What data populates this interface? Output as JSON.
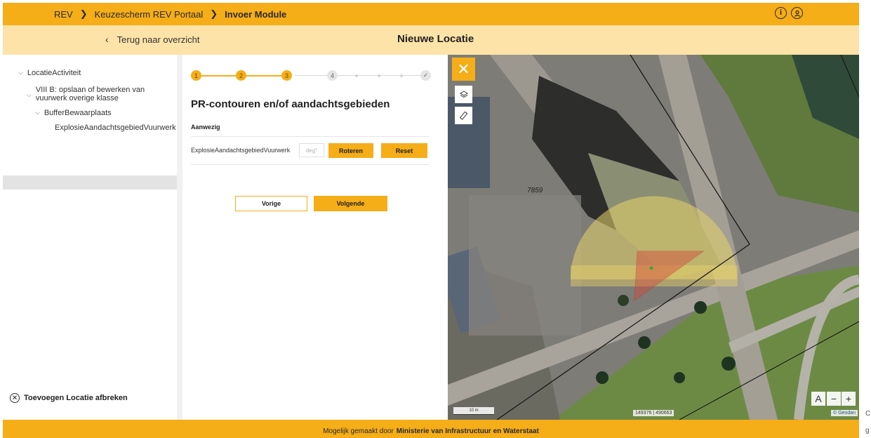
{
  "header": {
    "breadcrumbs": [
      "REV",
      "Keuzescherm REV Portaal",
      "Invoer Module"
    ],
    "info_icon": "info-icon",
    "user_icon": "user-icon"
  },
  "subheader": {
    "back_label": "Terug naar overzicht",
    "title": "Nieuwe Locatie"
  },
  "sidebar": {
    "tree": [
      {
        "label": "LocatieActiviteit",
        "level": 0,
        "expanded": true
      },
      {
        "label": "VIII B: opslaan of bewerken van",
        "label2": "vuurwerk overige klasse",
        "level": 1,
        "expanded": true
      },
      {
        "label": "BufferBewaarplaats",
        "level": 2,
        "expanded": true
      },
      {
        "label": "ExplosieAandachtsgebiedVuurwerk",
        "level": 3,
        "selected": true
      }
    ],
    "abort_label": "Toevoegen Locatie afbreken"
  },
  "stepper": {
    "steps": [
      "1",
      "2",
      "3",
      "4",
      "✓"
    ],
    "current": 3
  },
  "form": {
    "title": "PR-contouren en/of aandachtsgebieden",
    "section_label": "Aanwezig",
    "row": {
      "label": "ExplosieAandachtsgebiedVuurwerk",
      "degree_placeholder": "deg°",
      "rotate_label": "Roteren",
      "reset_label": "Reset"
    },
    "prev_label": "Vorige",
    "next_label": "Volgende"
  },
  "map": {
    "parcel_number": "7859",
    "scale_label": "10 m",
    "coordinates": "149376 | 490663",
    "credit": "© Geodan",
    "layers_icon": "layers-icon",
    "measure_icon": "ruler-icon",
    "label_toggle": "A",
    "zoom_out": "−",
    "zoom_in": "+",
    "colors": {
      "accent": "#f5ad18",
      "buffer_fill": "#e8d36a",
      "triangle": "#d9473a"
    }
  },
  "footer": {
    "prefix": "Mogelijk gemaakt door",
    "org": "Ministerie van Infrastructuur en Waterstaat"
  },
  "edge": {
    "char1": "C",
    "char2": "g"
  }
}
